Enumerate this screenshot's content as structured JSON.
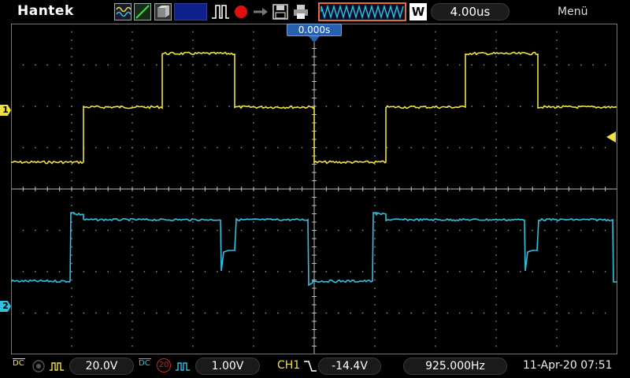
{
  "brand": "Hantek",
  "toolbar": {
    "icons": [
      "cursor-icon",
      "math-icon",
      "ref-icon",
      "blank-icon",
      "run-stop-icon",
      "record-icon",
      "export-icon",
      "save-icon",
      "print-icon"
    ],
    "timebase_waveform_icon": "timebase-waveform-icon",
    "acquire_mode": "W",
    "timebase": "4.00us",
    "menu": "Menü"
  },
  "screen": {
    "horizontal_position": "0.000s",
    "ch1_marker": "1",
    "ch2_marker": "2"
  },
  "status": {
    "ch1": {
      "coupling": "DC",
      "volts_per_div": "20.0V"
    },
    "ch2": {
      "coupling": "DC",
      "bw_limit": "20",
      "volts_per_div": "1.00V"
    },
    "trigger": {
      "source": "CH1",
      "level": "-14.4V"
    },
    "frequency": "925.000Hz",
    "datetime": "11-Apr-20 07:51"
  },
  "colors": {
    "ch1": "#f0e040",
    "ch2": "#30c0e0",
    "grid": "#9a9a9a",
    "accent": "#2860b0",
    "highlight": "#e07030"
  }
}
